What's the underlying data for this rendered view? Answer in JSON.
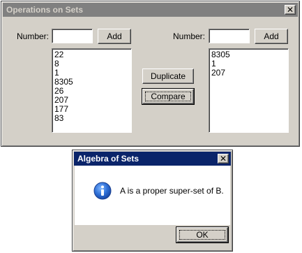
{
  "main_window": {
    "title": "Operations on Sets",
    "close_glyph": "✕",
    "left": {
      "number_label": "Number:",
      "number_value": "",
      "add_label": "Add",
      "items": [
        "22",
        "8",
        "1",
        "8305",
        "26",
        "207",
        "177",
        "83"
      ]
    },
    "right": {
      "number_label": "Number:",
      "number_value": "",
      "add_label": "Add",
      "items": [
        "8305",
        "1",
        "207"
      ]
    },
    "duplicate_label": "Duplicate",
    "compare_label": "Compare"
  },
  "dialog": {
    "title": "Algebra of Sets",
    "close_glyph": "✕",
    "icon": "info-icon",
    "message": "A is a proper super-set of B.",
    "ok_label": "OK"
  },
  "colors": {
    "face": "#d4d0c8",
    "active_title": "#0a246a",
    "inactive_title": "#808080",
    "info_blue": "#1f5fc7"
  }
}
